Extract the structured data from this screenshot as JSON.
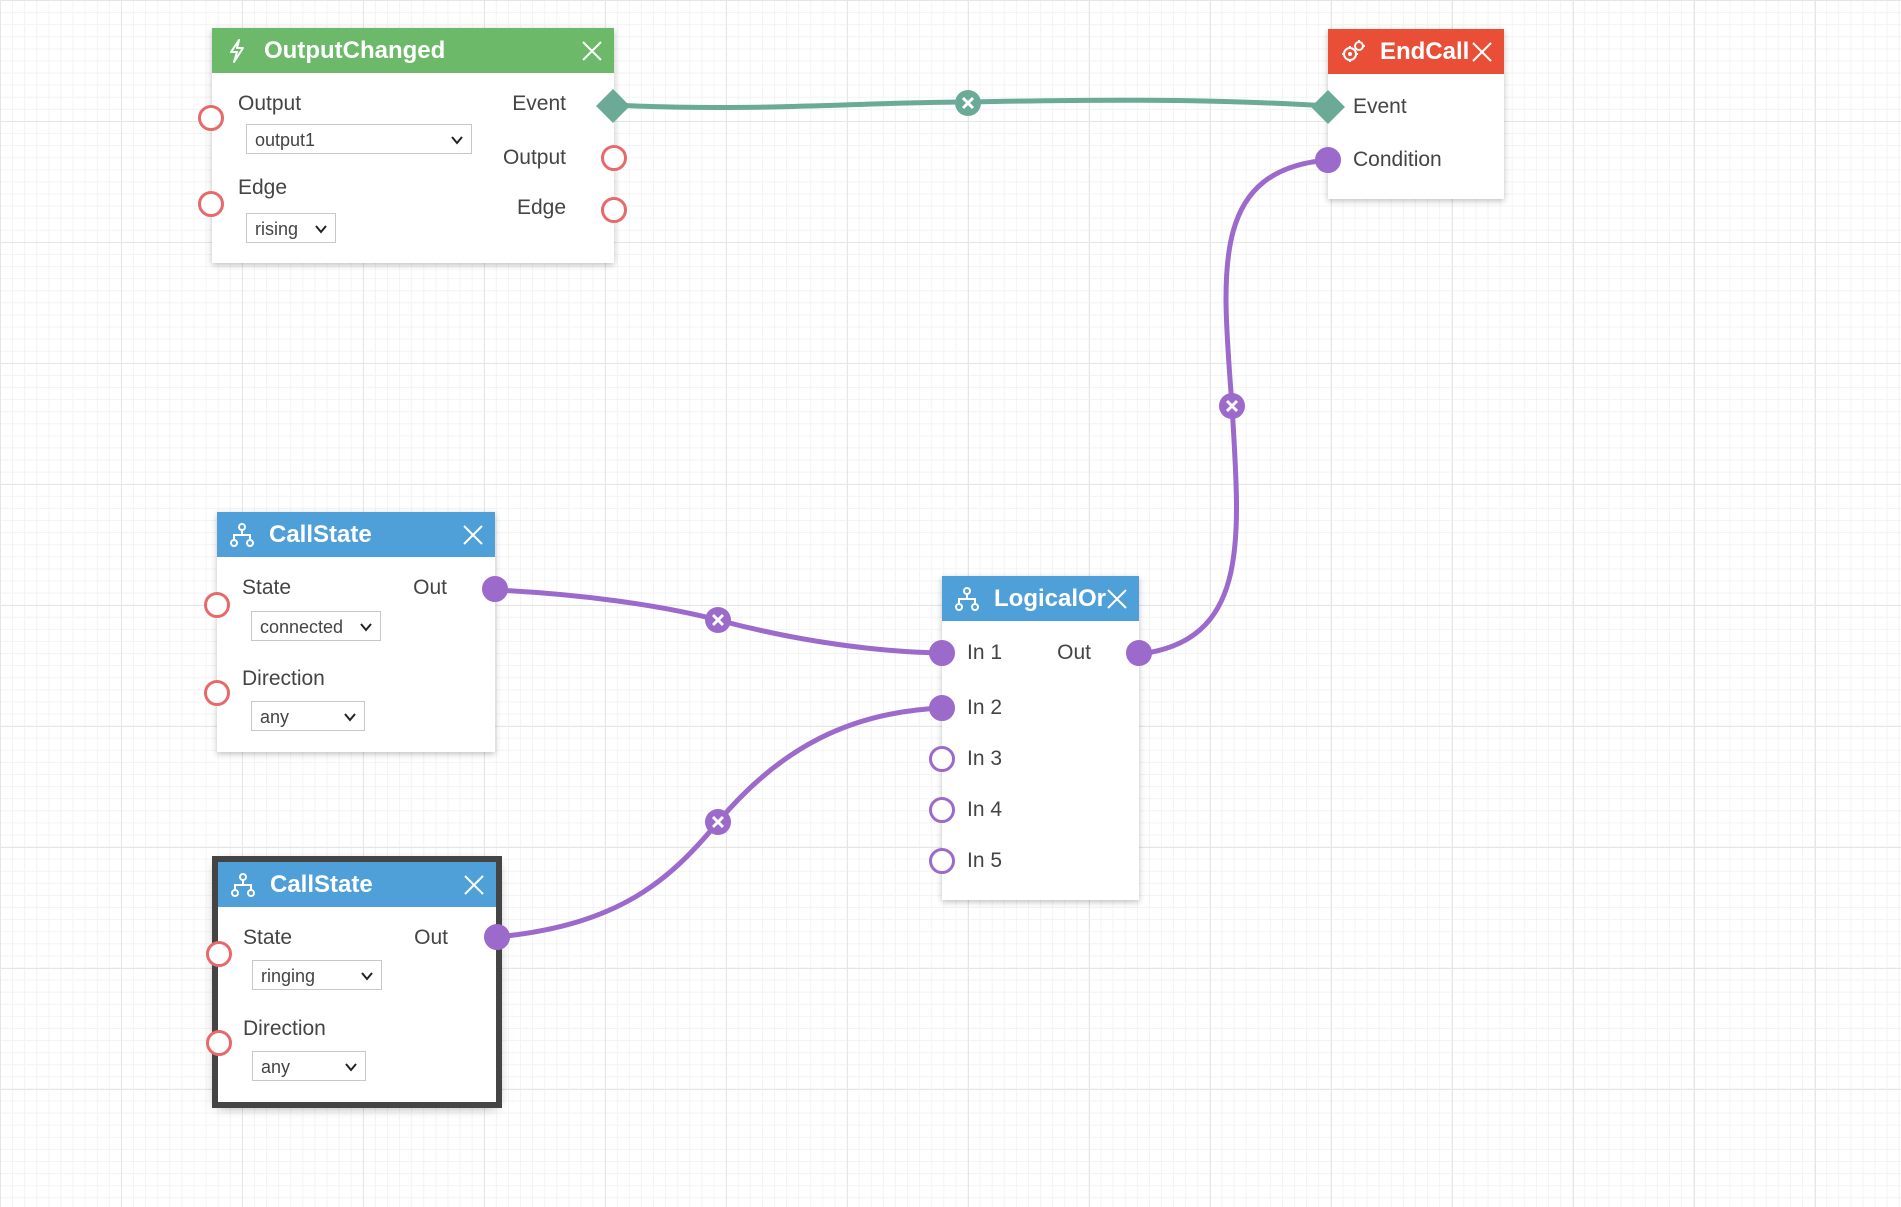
{
  "colors": {
    "green_header": "#6cb96a",
    "red_header": "#e94f36",
    "blue_header": "#4f9fd8",
    "event_wire": "#6aaa96",
    "logic_wire": "#9b6acb",
    "port_red": "#e8696b"
  },
  "output_changed": {
    "title": "OutputChanged",
    "icon": "lightning-icon",
    "output_label": "Output",
    "output_value": "output1",
    "edge_label": "Edge",
    "edge_value": "rising",
    "event_out": "Event",
    "output_out": "Output",
    "edge_out": "Edge"
  },
  "end_call": {
    "title": "EndCall",
    "icon": "gears-icon",
    "event_in": "Event",
    "condition_in": "Condition"
  },
  "call_state_1": {
    "title": "CallState",
    "icon": "hierarchy-icon",
    "state_label": "State",
    "state_value": "connected",
    "direction_label": "Direction",
    "direction_value": "any",
    "out_label": "Out"
  },
  "call_state_2": {
    "title": "CallState",
    "icon": "hierarchy-icon",
    "state_label": "State",
    "state_value": "ringing",
    "direction_label": "Direction",
    "direction_value": "any",
    "out_label": "Out"
  },
  "logical_or": {
    "title": "LogicalOr",
    "icon": "hierarchy-icon",
    "inputs": [
      "In 1",
      "In 2",
      "In 3",
      "In 4",
      "In 5"
    ],
    "out_label": "Out"
  }
}
